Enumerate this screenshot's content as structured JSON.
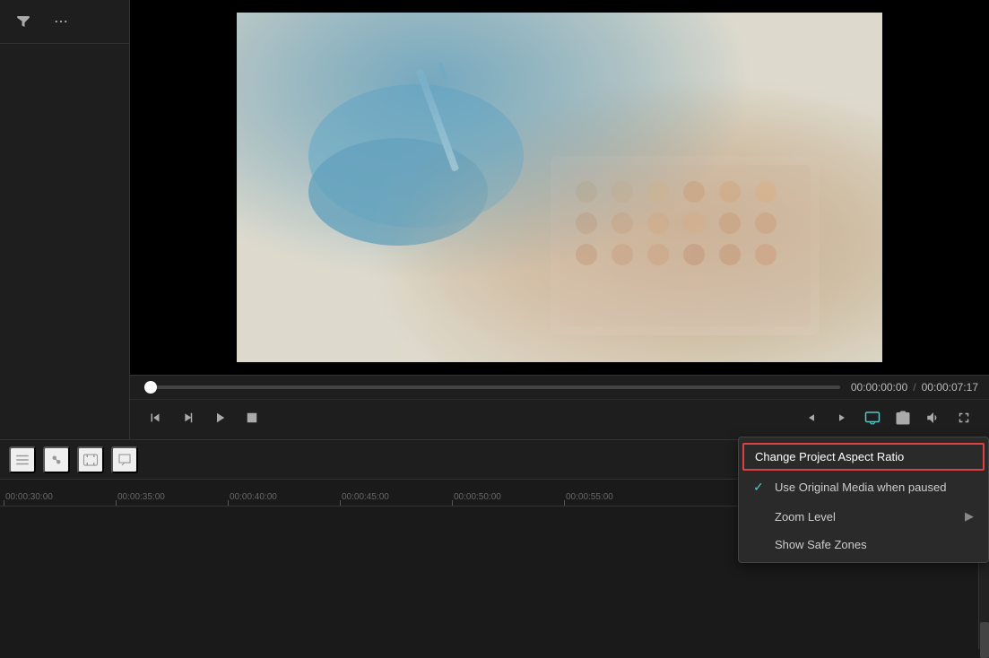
{
  "sidebar": {
    "filter_icon": "filter",
    "more_icon": "ellipsis"
  },
  "preview": {
    "current_time": "00:00:00:00",
    "separator": "/",
    "total_time": "00:00:07:17"
  },
  "timeline": {
    "ruler_ticks": [
      "00:00:30:00",
      "00:00:35:00",
      "00:00:40:00",
      "00:00:45:00",
      "00:00:50:00",
      "00:00:55:00"
    ]
  },
  "context_menu": {
    "change_aspect_ratio": "Change Project Aspect Ratio",
    "use_original_media": "Use Original Media when paused",
    "zoom_level": "Zoom Level",
    "show_safe_zones": "Show Safe Zones"
  }
}
